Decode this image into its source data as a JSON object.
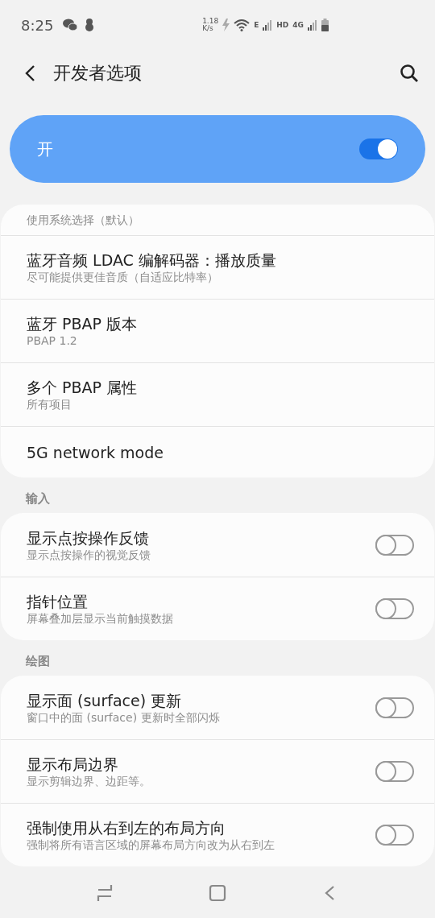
{
  "status_bar": {
    "time": "8:25",
    "speed_value": "1.18",
    "speed_unit": "K/s",
    "signal_1_label": "E",
    "hd_label": "HD",
    "signal_2_label": "4G"
  },
  "header": {
    "title": "开发者选项"
  },
  "master_switch": {
    "label": "开",
    "on": true
  },
  "sections": [
    {
      "rows": [
        {
          "kind": "text",
          "subtitle": "使用系统选择（默认）"
        },
        {
          "kind": "text",
          "title": "蓝牙音频 LDAC 编解码器：播放质量",
          "subtitle": "尽可能提供更佳音质（自适应比特率）"
        },
        {
          "kind": "text",
          "title": "蓝牙 PBAP 版本",
          "subtitle": "PBAP 1.2"
        },
        {
          "kind": "text",
          "title": "多个 PBAP 属性",
          "subtitle": "所有项目"
        },
        {
          "kind": "text",
          "title": "5G network mode"
        }
      ]
    },
    {
      "title": "输入",
      "rows": [
        {
          "kind": "switch",
          "title": "显示点按操作反馈",
          "subtitle": "显示点按操作的视觉反馈",
          "on": false
        },
        {
          "kind": "switch",
          "title": "指针位置",
          "subtitle": "屏幕叠加层显示当前触摸数据",
          "on": false
        }
      ]
    },
    {
      "title": "绘图",
      "rows": [
        {
          "kind": "switch",
          "title": "显示面 (surface) 更新",
          "subtitle": "窗口中的面 (surface) 更新时全部闪烁",
          "on": false
        },
        {
          "kind": "switch",
          "title": "显示布局边界",
          "subtitle": "显示剪辑边界、边距等。",
          "on": false
        },
        {
          "kind": "switch",
          "title": "强制使用从右到左的布局方向",
          "subtitle": "强制将所有语言区域的屏幕布局方向改为从右到左",
          "on": false
        }
      ]
    }
  ]
}
